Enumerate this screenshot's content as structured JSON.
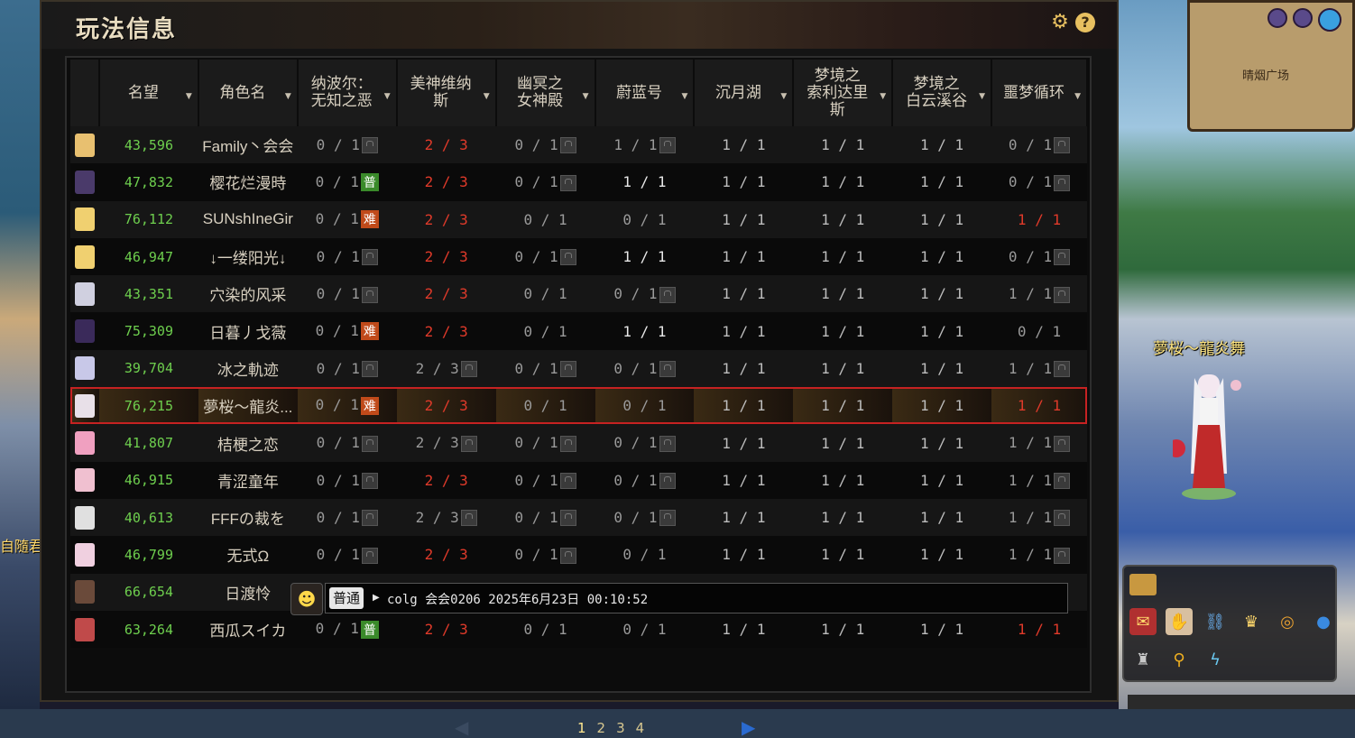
{
  "panel": {
    "title": "玩法信息",
    "gear_icon": "⚙",
    "help_icon": "?"
  },
  "columns": [
    {
      "label": ""
    },
    {
      "label": "名望"
    },
    {
      "label": "角色名"
    },
    {
      "label": "纳波尔：\n无知之恶"
    },
    {
      "label": "美神维纳\n斯"
    },
    {
      "label": "幽冥之\n女神殿"
    },
    {
      "label": "蔚蓝号"
    },
    {
      "label": "沉月湖"
    },
    {
      "label": "梦境之\n索利达里\n斯"
    },
    {
      "label": "梦境之\n白云溪谷"
    },
    {
      "label": "噩梦循环"
    }
  ],
  "rows": [
    {
      "fame": "43,596",
      "name": "Family丶会会",
      "cells": [
        [
          "0 / 1",
          "lock"
        ],
        [
          "2 / 3",
          "red"
        ],
        [
          "0 / 1",
          "lock"
        ],
        [
          "1 / 1",
          "lock"
        ],
        [
          "1 / 1",
          ""
        ],
        [
          "1 / 1",
          ""
        ],
        [
          "1 / 1",
          ""
        ],
        [
          "0 / 1",
          "lock"
        ]
      ],
      "avatar": "#e8c070"
    },
    {
      "fame": "47,832",
      "name": "樱花烂漫時",
      "cells": [
        [
          "0 / 1",
          "pu"
        ],
        [
          "2 / 3",
          "red"
        ],
        [
          "0 / 1",
          "lock"
        ],
        [
          "1 / 1",
          "white"
        ],
        [
          "1 / 1",
          ""
        ],
        [
          "1 / 1",
          ""
        ],
        [
          "1 / 1",
          ""
        ],
        [
          "0 / 1",
          "lock"
        ]
      ],
      "avatar": "#4a3a6a"
    },
    {
      "fame": "76,112",
      "name": "SUNshIneGir",
      "cells": [
        [
          "0 / 1",
          "nan"
        ],
        [
          "2 / 3",
          "red"
        ],
        [
          "0 / 1",
          "gray"
        ],
        [
          "0 / 1",
          "gray"
        ],
        [
          "1 / 1",
          ""
        ],
        [
          "1 / 1",
          ""
        ],
        [
          "1 / 1",
          ""
        ],
        [
          "1 / 1",
          "red"
        ]
      ],
      "avatar": "#f0d070"
    },
    {
      "fame": "46,947",
      "name": "↓一缕阳光↓",
      "cells": [
        [
          "0 / 1",
          "lock"
        ],
        [
          "2 / 3",
          "red"
        ],
        [
          "0 / 1",
          "lock"
        ],
        [
          "1 / 1",
          "white"
        ],
        [
          "1 / 1",
          ""
        ],
        [
          "1 / 1",
          ""
        ],
        [
          "1 / 1",
          ""
        ],
        [
          "0 / 1",
          "lock"
        ]
      ],
      "avatar": "#f0d070"
    },
    {
      "fame": "43,351",
      "name": "穴染的风采",
      "cells": [
        [
          "0 / 1",
          "lock"
        ],
        [
          "2 / 3",
          "red"
        ],
        [
          "0 / 1",
          "gray"
        ],
        [
          "0 / 1",
          "lock"
        ],
        [
          "1 / 1",
          ""
        ],
        [
          "1 / 1",
          ""
        ],
        [
          "1 / 1",
          ""
        ],
        [
          "1 / 1",
          "lock"
        ]
      ],
      "avatar": "#d0d0e0"
    },
    {
      "fame": "75,309",
      "name": "日暮丿戈薇",
      "cells": [
        [
          "0 / 1",
          "nan"
        ],
        [
          "2 / 3",
          "red"
        ],
        [
          "0 / 1",
          "gray"
        ],
        [
          "1 / 1",
          "white"
        ],
        [
          "1 / 1",
          ""
        ],
        [
          "1 / 1",
          ""
        ],
        [
          "1 / 1",
          ""
        ],
        [
          "0 / 1",
          "gray"
        ]
      ],
      "avatar": "#3a2a5a"
    },
    {
      "fame": "39,704",
      "name": "冰之軌迹",
      "cells": [
        [
          "0 / 1",
          "lock"
        ],
        [
          "2 / 3",
          "lock"
        ],
        [
          "0 / 1",
          "lock"
        ],
        [
          "0 / 1",
          "lock"
        ],
        [
          "1 / 1",
          ""
        ],
        [
          "1 / 1",
          ""
        ],
        [
          "1 / 1",
          ""
        ],
        [
          "1 / 1",
          "lock"
        ]
      ],
      "avatar": "#c8c8e8"
    },
    {
      "fame": "76,215",
      "name": "夢桜～龍炎...",
      "cells": [
        [
          "0 / 1",
          "nan"
        ],
        [
          "2 / 3",
          "red"
        ],
        [
          "0 / 1",
          "gray"
        ],
        [
          "0 / 1",
          "gray"
        ],
        [
          "1 / 1",
          ""
        ],
        [
          "1 / 1",
          ""
        ],
        [
          "1 / 1",
          ""
        ],
        [
          "1 / 1",
          "red"
        ]
      ],
      "avatar": "#e8e0e8",
      "selected": true
    },
    {
      "fame": "41,807",
      "name": "桔梗之恋",
      "cells": [
        [
          "0 / 1",
          "lock"
        ],
        [
          "2 / 3",
          "lock"
        ],
        [
          "0 / 1",
          "lock"
        ],
        [
          "0 / 1",
          "lock"
        ],
        [
          "1 / 1",
          ""
        ],
        [
          "1 / 1",
          ""
        ],
        [
          "1 / 1",
          ""
        ],
        [
          "1 / 1",
          "lock"
        ]
      ],
      "avatar": "#f0a0c0"
    },
    {
      "fame": "46,915",
      "name": "青涩童年",
      "cells": [
        [
          "0 / 1",
          "lock"
        ],
        [
          "2 / 3",
          "red"
        ],
        [
          "0 / 1",
          "lock"
        ],
        [
          "0 / 1",
          "lock"
        ],
        [
          "1 / 1",
          ""
        ],
        [
          "1 / 1",
          ""
        ],
        [
          "1 / 1",
          ""
        ],
        [
          "1 / 1",
          "lock"
        ]
      ],
      "avatar": "#f0c0d0"
    },
    {
      "fame": "40,613",
      "name": "FFFの裁を",
      "cells": [
        [
          "0 / 1",
          "lock"
        ],
        [
          "2 / 3",
          "lock"
        ],
        [
          "0 / 1",
          "lock"
        ],
        [
          "0 / 1",
          "lock"
        ],
        [
          "1 / 1",
          ""
        ],
        [
          "1 / 1",
          ""
        ],
        [
          "1 / 1",
          ""
        ],
        [
          "1 / 1",
          "lock"
        ]
      ],
      "avatar": "#e0e0e0"
    },
    {
      "fame": "46,799",
      "name": "无式Ω",
      "cells": [
        [
          "0 / 1",
          "lock"
        ],
        [
          "2 / 3",
          "red"
        ],
        [
          "0 / 1",
          "lock"
        ],
        [
          "0 / 1",
          "gray"
        ],
        [
          "1 / 1",
          ""
        ],
        [
          "1 / 1",
          ""
        ],
        [
          "1 / 1",
          ""
        ],
        [
          "1 / 1",
          "lock"
        ]
      ],
      "avatar": "#f0d0e0"
    },
    {
      "fame": "66,654",
      "name": "日渡怜",
      "cells": [
        [
          "",
          ""
        ],
        [
          "",
          ""
        ],
        [
          "",
          ""
        ],
        [
          "",
          ""
        ],
        [
          "",
          ""
        ],
        [
          "",
          ""
        ],
        [
          "",
          ""
        ],
        [
          "",
          ""
        ]
      ],
      "avatar": "#6a4a3a"
    },
    {
      "fame": "63,264",
      "name": "西瓜スイカ",
      "cells": [
        [
          "0 / 1",
          "pu"
        ],
        [
          "2 / 3",
          "red"
        ],
        [
          "0 / 1",
          "gray"
        ],
        [
          "0 / 1",
          "gray"
        ],
        [
          "1 / 1",
          ""
        ],
        [
          "1 / 1",
          ""
        ],
        [
          "1 / 1",
          ""
        ],
        [
          "1 / 1",
          "red"
        ]
      ],
      "avatar": "#c04a4a"
    }
  ],
  "badges": {
    "pu": "普",
    "nan": "难"
  },
  "chat": {
    "emoji": "☻",
    "channel": "普通",
    "text": "colg 会会0206 2025年6月23日 00:10:52"
  },
  "pager": {
    "prev": "◀",
    "next": "▶",
    "pages": [
      "1",
      "2",
      "3",
      "4"
    ]
  },
  "scene": {
    "character_name": "夢桜～龍炎舞",
    "minimap_location": "晴烟广场",
    "left_label": "自隨君"
  },
  "colors": {
    "fame": "#6ecf4e",
    "red": "#e03a2a",
    "selected_border": "#c62222",
    "next_arrow": "#2a6ad0"
  }
}
